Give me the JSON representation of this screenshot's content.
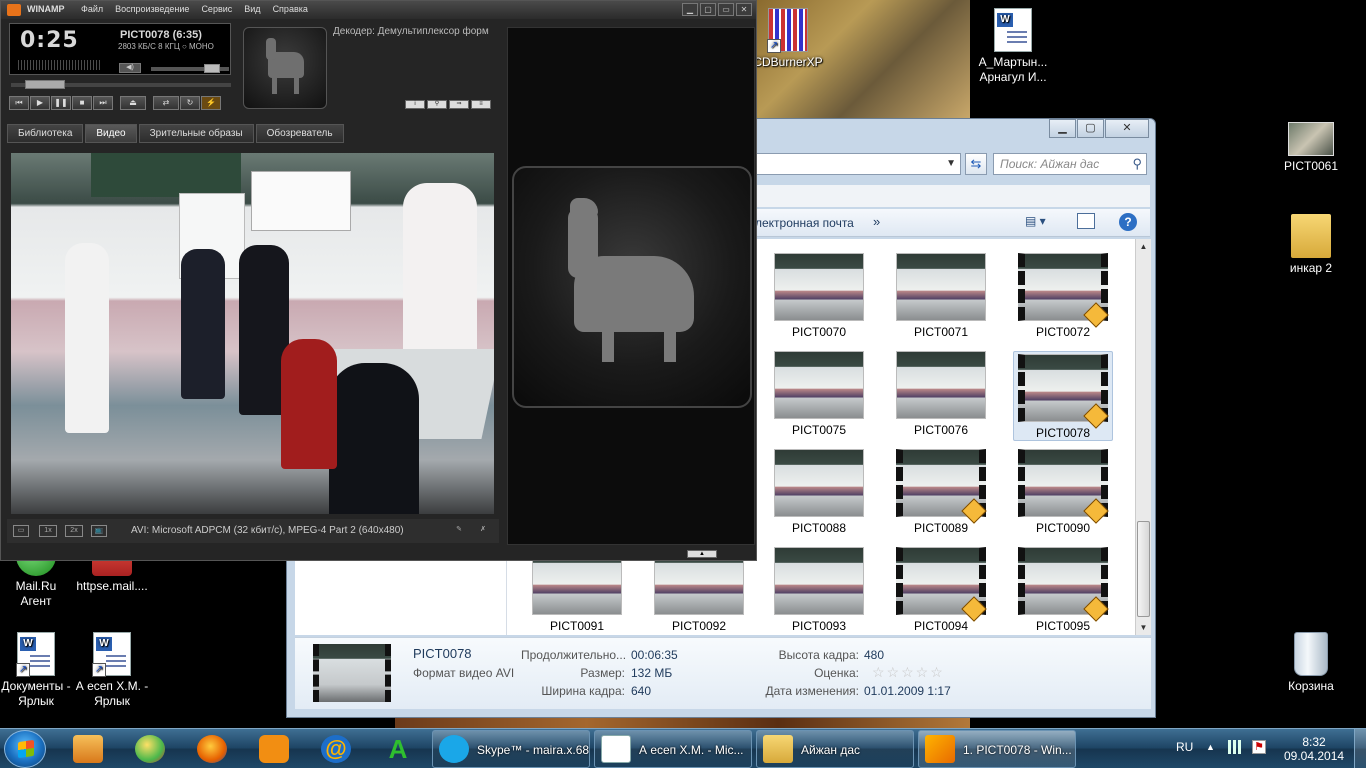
{
  "desktop": {
    "icons": [
      {
        "id": "cdburner",
        "label": "CDBurnerXP"
      },
      {
        "id": "martynova",
        "label": "А_Мартын...\nАрнагул И..."
      },
      {
        "id": "pict0061",
        "label": "PICT0061"
      },
      {
        "id": "inkar2",
        "label": "инкар 2"
      },
      {
        "id": "mailru",
        "label": "Mail.Ru\nАгент"
      },
      {
        "id": "httpsemail",
        "label": "httpse.mail...."
      },
      {
        "id": "documents",
        "label": "Документы -\nЯрлык"
      },
      {
        "id": "esep",
        "label": "А есеп Х.М. -\nЯрлык"
      },
      {
        "id": "recycle",
        "label": "Корзина"
      }
    ]
  },
  "winamp": {
    "app_name": "WINAMP",
    "menu": [
      "Файл",
      "Воспроизведение",
      "Сервис",
      "Вид",
      "Справка"
    ],
    "time": "0:25",
    "track": "PICT0078 (6:35)",
    "bitrate": "2803 КБ/С  8 КГЦ  ○ МОНО",
    "decoder": "Декодер: Демультиплексор форм",
    "tabs": [
      "Библиотека",
      "Видео",
      "Зрительные образы",
      "Обозреватель"
    ],
    "active_tab": "Видео",
    "status_text": "AVI: Microsoft ADPCM (32 кбит/с), MPEG-4 Part 2 (640x480)",
    "seek_fraction": 0.064,
    "volume_fraction": 0.85,
    "zoom_1x": "1x",
    "zoom_2x": "2x"
  },
  "explorer": {
    "search_placeholder": "Поиск: Айжан дас",
    "toolbar_email": "лектронная почта",
    "toolbar_more": "»",
    "thumbnails": [
      {
        "name": "PICT0070",
        "film": false
      },
      {
        "name": "PICT0071",
        "film": false
      },
      {
        "name": "PICT0072",
        "film": true
      },
      {
        "name": "PICT0075",
        "film": false
      },
      {
        "name": "PICT0076",
        "film": false
      },
      {
        "name": "PICT0078",
        "film": true,
        "selected": true
      },
      {
        "name": "PICT0088",
        "film": false
      },
      {
        "name": "PICT0089",
        "film": true
      },
      {
        "name": "PICT0090",
        "film": true
      },
      {
        "name": "PICT0091",
        "film": false
      },
      {
        "name": "PICT0092",
        "film": false
      },
      {
        "name": "PICT0093",
        "film": false
      },
      {
        "name": "PICT0094",
        "film": true
      },
      {
        "name": "PICT0095",
        "film": true
      }
    ],
    "details": {
      "name": "PICT0078",
      "type": "Формат видео AVI",
      "duration_label": "Продолжительно...",
      "duration": "00:06:35",
      "size_label": "Размер:",
      "size": "132 МБ",
      "width_label": "Ширина кадра:",
      "width": "640",
      "height_label": "Высота кадра:",
      "height": "480",
      "rating_label": "Оценка:",
      "rating": "☆☆☆☆☆",
      "modified_label": "Дата изменения:",
      "modified": "01.01.2009 1:17"
    }
  },
  "taskbar": {
    "tasks": [
      {
        "label": "Skype™ - maira.x.68",
        "active": false
      },
      {
        "label": "А есеп Х.М. - Mic...",
        "active": false
      },
      {
        "label": "Айжан дас",
        "active": false
      },
      {
        "label": "1. PICT0078 - Win...",
        "active": true
      }
    ],
    "lang": "RU",
    "time": "8:32",
    "date": "09.04.2014"
  },
  "colors": {
    "taskbar": "#1e4565",
    "winamp_bg": "#252525",
    "explorer_frame": "#c7d7e8",
    "selection": "#dde8f4"
  }
}
